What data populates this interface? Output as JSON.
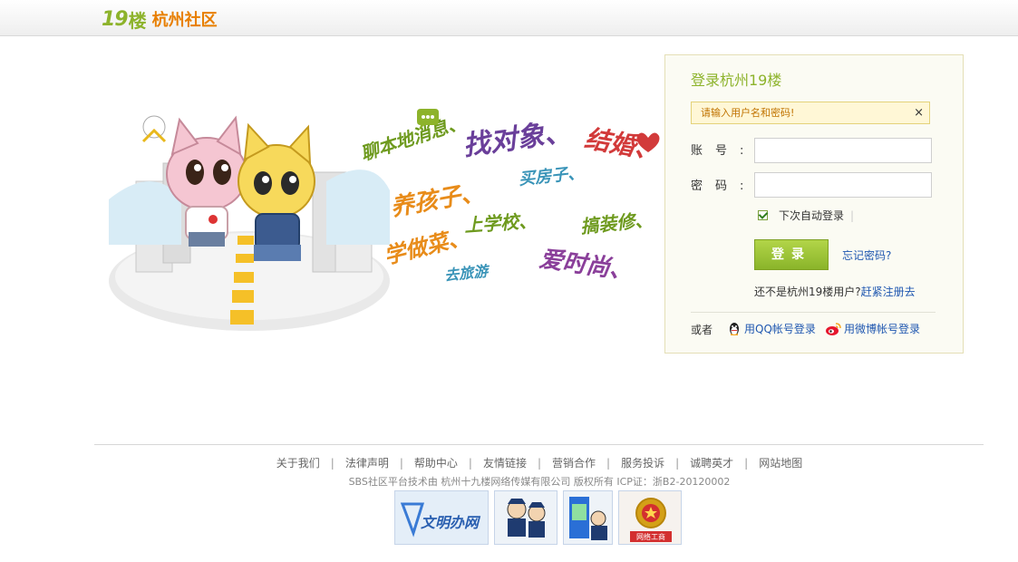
{
  "header": {
    "logo_num": "19",
    "logo_lou": "楼",
    "logo_site": "杭州社区"
  },
  "illustration": {
    "words": [
      "聊本地消息、",
      "找对象、",
      "结婚、",
      "养孩子、",
      "买房子、",
      "上学校、",
      "搞装修、",
      "学做菜、",
      "去旅游",
      "爱时尚、"
    ]
  },
  "login": {
    "title": "登录杭州19楼",
    "alert": "请输入用户名和密码!",
    "alert_close": "×",
    "account_label": "账号:",
    "password_label": "密码:",
    "account_value": "",
    "password_value": "",
    "remember_label": "下次自动登录",
    "remember_checked": true,
    "remember_sep": "|",
    "login_button": "登录",
    "forgot_link": "忘记密码?",
    "not_user_text": "还不是杭州19楼用户?",
    "register_link": "赶紧注册去",
    "or_text": "或者",
    "qq_login": "用QQ帐号登录",
    "weibo_login": "用微博帐号登录"
  },
  "footer": {
    "links": [
      "关于我们",
      "法律声明",
      "帮助中心",
      "友情链接",
      "营销合作",
      "服务投诉",
      "诚聘英才",
      "网站地图"
    ],
    "copyright": "SBS社区平台技术由 杭州十九楼网络传媒有限公司 版权所有 ICP证：浙B2-20120002",
    "badges": [
      "wenming-badge",
      "police-badge",
      "police-kiosk-badge",
      "gongshang-badge"
    ],
    "badge_texts": {
      "wenming": "文明办网",
      "gongshang": "网络工商"
    }
  },
  "colors": {
    "brand_green": "#8db32b",
    "brand_orange": "#e87f00",
    "link_blue": "#1f57b0"
  }
}
